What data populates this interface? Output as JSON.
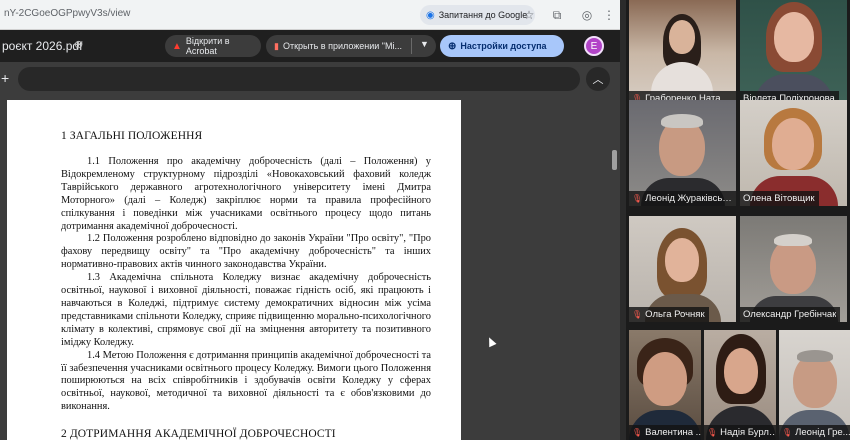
{
  "browser": {
    "url": "nY-2CGoeOGPpwyV3s/view",
    "ask_google_label": "Запитання до Google",
    "icons": [
      "google-lens-icon",
      "star-icon",
      "extensions-icon",
      "profile-icon",
      "kebab-menu-icon"
    ]
  },
  "viewer": {
    "doc_title": "роєкт 2026.pdf",
    "acrobat_label": "Відкрити в Acrobat",
    "open_in_app_label": "Открыть в приложении \"Мі...",
    "access_label": "Настройки доступа",
    "avatar_letter": "E",
    "accent_color": "#a8c7fa"
  },
  "document": {
    "section1_title": "1 ЗАГАЛЬНІ ПОЛОЖЕННЯ",
    "paragraphs": [
      "1.1 Положення про академічну доброчесність (далі – Положення) у Відокремленому структурному підрозділі «Новокаховський фаховий коледж Таврійського державного агротехнологічного університету імені Дмитра Моторного» (далі – Коледж) закріплює норми та правила професійного спілкування і поведінки між учасниками освітнього процесу щодо питань дотримання академічної доброчесності.",
      "1.2 Положення розроблено відповідно до законів України \"Про освіту\", \"Про фахову передвищу освіту\" та \"Про академічну доброчесність\" та інших нормативно-правових актів чинного законодавства України.",
      "1.3 Академічна спільнота Коледжу визнає академічну доброчесність освітньої, наукової і виховної діяльності, поважає гідність осіб, які працюють і навчаються в Коледжі, підтримує систему демократичних відносин між усіма представниками спільноти Коледжу, сприяє підвищенню морально-психологічного клімату в колективі, спрямовує свої дії на зміцнення авторитету та позитивного іміджу Коледжу.",
      "1.4 Метою Положення є дотримання принципів академічної доброчесності та її забезпечення учасниками освітнього процесу Коледжу. Вимоги цього Положення поширюються на всіх співробітників і здобувачів освіти Коледжу у сферах освітньої, наукової, методичної та виховної діяльності та є обов'язковими до виконання."
    ],
    "section2_title": "2 ДОТРИМАННЯ АКАДЕМІЧНОЇ ДОБРОЧЕСНОСТІ"
  },
  "participants": [
    {
      "name": "Граборенко Наталія",
      "muted": true
    },
    {
      "name": "Віолета Поліхронова",
      "muted": false
    },
    {
      "name": "Леонід Жураківський",
      "muted": true
    },
    {
      "name": "Олена Вітовщик",
      "muted": false
    },
    {
      "name": "Ольга Рочняк",
      "muted": true
    },
    {
      "name": "Олександр Гребінчак",
      "muted": false
    },
    {
      "name": "Валентина ...",
      "muted": true
    },
    {
      "name": "Надія Бурла...",
      "muted": true
    },
    {
      "name": "Леонід Гре...",
      "muted": true
    }
  ]
}
